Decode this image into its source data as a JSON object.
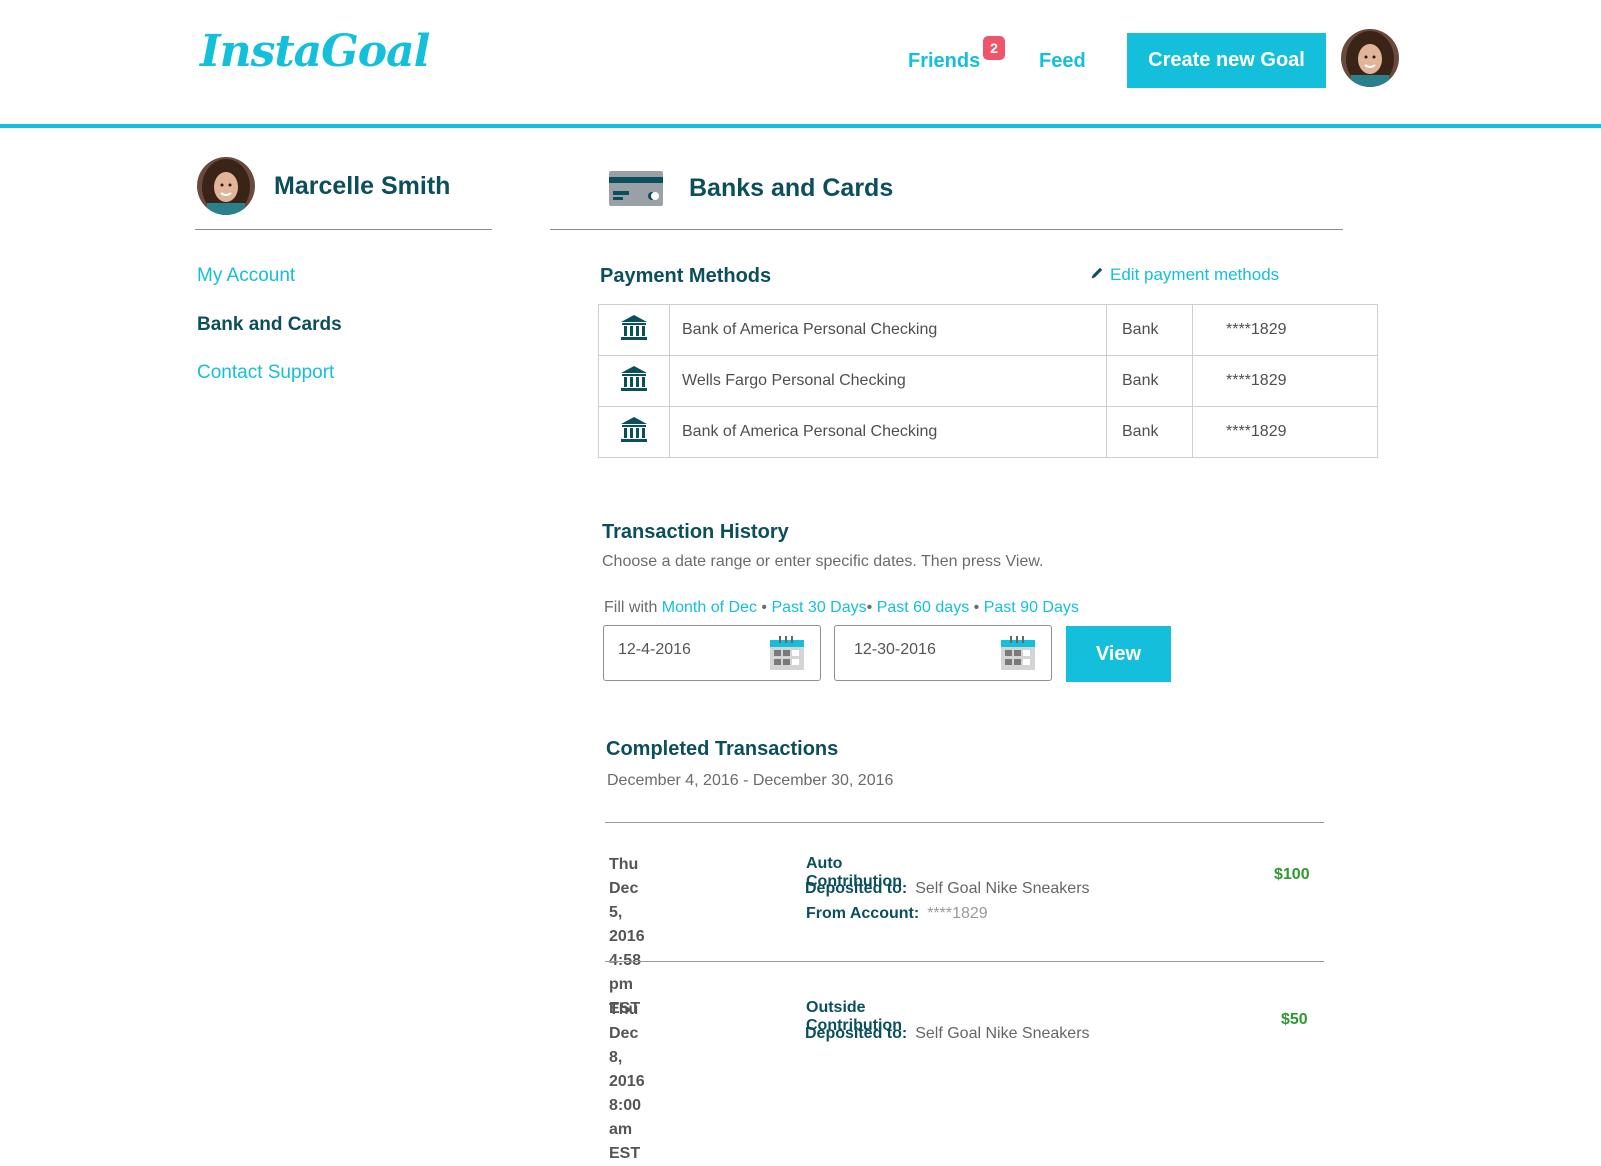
{
  "header": {
    "logo": "InstaGoal",
    "friends_label": "Friends",
    "friends_badge": "2",
    "feed_label": "Feed",
    "create_label": "Create new Goal"
  },
  "colors": {
    "accent": "#14bfdb",
    "heading": "#0c4f5c",
    "badge": "#f0546a",
    "amount": "#2e9a2e"
  },
  "sidebar": {
    "user_name": "Marcelle Smith",
    "items": [
      {
        "label": "My Account",
        "active": false
      },
      {
        "label": "Bank and Cards",
        "active": true
      },
      {
        "label": "Contact Support",
        "active": false
      }
    ]
  },
  "main": {
    "title": "Banks and Cards",
    "title_icon": "credit-card-icon"
  },
  "payment_methods": {
    "title": "Payment Methods",
    "edit_label": "Edit payment methods",
    "edit_icon": "pencil-icon",
    "rows": [
      {
        "icon": "bank-icon",
        "name": "Bank of America Personal Checking",
        "type": "Bank",
        "account": "****1829"
      },
      {
        "icon": "bank-icon",
        "name": "Wells Fargo Personal Checking",
        "type": "Bank",
        "account": "****1829"
      },
      {
        "icon": "bank-icon",
        "name": "Bank of America Personal Checking",
        "type": "Bank",
        "account": "****1829"
      }
    ]
  },
  "history": {
    "title": "Transaction History",
    "instructions": "Choose a date range or enter specific dates. Then press View.",
    "fill_with": "Fill with",
    "fill_options": [
      "Month of Dec",
      "Past 30 Days",
      "Past 60 days",
      "Past 90 Days"
    ],
    "separator": "•",
    "start_date": "12-4-2016",
    "end_date": "12-30-2016",
    "view_label": "View"
  },
  "completed": {
    "title": "Completed Transactions",
    "range": "December 4, 2016 - December 30, 2016",
    "transactions": [
      {
        "date": "Thu Dec 5, 2016",
        "time": "4:58 pm EST",
        "type": "Auto Contribution",
        "deposited_label": "Deposited to:",
        "deposited_value": "Self Goal Nike Sneakers",
        "from_label": "From Account:",
        "from_value": "****1829",
        "amount": "$100"
      },
      {
        "date": "Thu Dec 8, 2016",
        "time": "8:00 am EST",
        "type": "Outside Contribution",
        "deposited_label": "Deposited to:",
        "deposited_value": "Self Goal Nike Sneakers",
        "amount": "$50"
      }
    ]
  }
}
